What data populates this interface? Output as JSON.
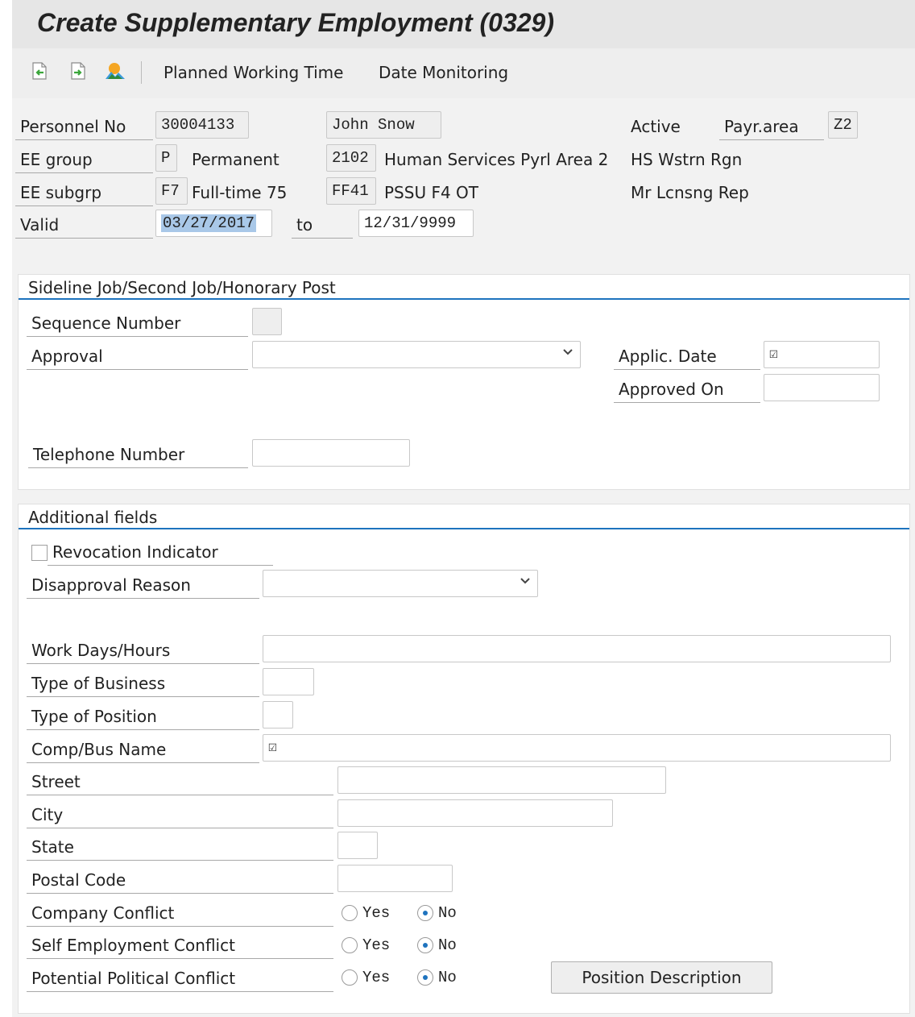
{
  "title": "Create Supplementary Employment (0329)",
  "toolbar": {
    "icons": [
      "previous-record-icon",
      "next-record-icon",
      "overview-icon"
    ],
    "planned_working_time": "Planned Working Time",
    "date_monitoring": "Date Monitoring"
  },
  "header": {
    "personnel_no_label": "Personnel No",
    "personnel_no": "30004133",
    "name": "John Snow",
    "status": "Active",
    "payr_area_label": "Payr.area",
    "payr_area": "Z2",
    "ee_group_label": "EE group",
    "ee_group_code": "P",
    "ee_group_text": "Permanent",
    "pers_area_code": "2102",
    "pers_area_text": "Human Services Pyrl Area 2",
    "region": "HS Wstrn Rgn",
    "ee_subgrp_label": "EE subgrp",
    "ee_subgrp_code": "F7",
    "ee_subgrp_text": "Full-time 75",
    "subarea_code": "FF41",
    "subarea_text": "PSSU F4 OT",
    "rep": "Mr Lcnsng Rep",
    "valid_label": "Valid",
    "valid_from": "03/27/2017",
    "to_label": "to",
    "valid_to": "12/31/9999"
  },
  "sideline": {
    "title": "Sideline Job/Second Job/Honorary Post",
    "sequence_label": "Sequence Number",
    "sequence_value": "",
    "approval_label": "Approval",
    "approval_value": "",
    "applic_date_label": "Applic. Date",
    "approved_on_label": "Approved On",
    "approved_on_value": "",
    "telephone_label": "Telephone Number",
    "telephone_value": ""
  },
  "additional": {
    "title": "Additional fields",
    "revocation_label": "Revocation Indicator",
    "revocation_checked": false,
    "disapproval_label": "Disapproval Reason",
    "disapproval_value": "",
    "work_days_label": "Work Days/Hours",
    "type_business_label": "Type of Business",
    "type_position_label": "Type of Position",
    "comp_name_label": "Comp/Bus Name",
    "street_label": "Street",
    "city_label": "City",
    "state_label": "State",
    "postal_label": "Postal Code",
    "yes_label": "Yes",
    "no_label": "No",
    "company_conflict_label": "Company Conflict",
    "self_employment_label": "Self Employment Conflict",
    "political_conflict_label": "Potential Political Conflict",
    "company_conflict_value": "No",
    "self_employment_value": "No",
    "political_conflict_value": "No",
    "position_description_button": "Position Description"
  },
  "colors": {
    "accent": "#1e73be",
    "selection": "#a9c8e8",
    "background": "#f2f2f2"
  }
}
